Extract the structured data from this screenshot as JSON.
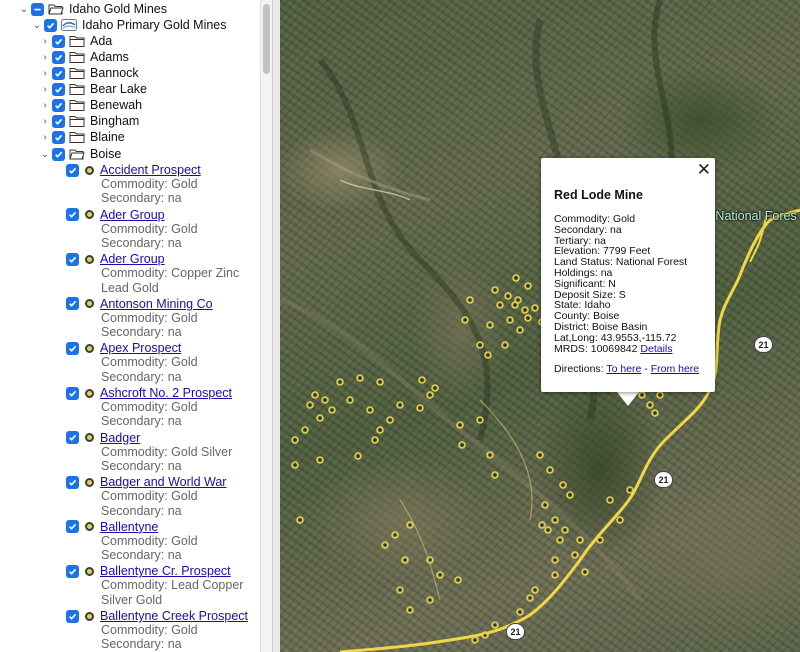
{
  "tree": {
    "root": {
      "label": "Idaho Gold Mines"
    },
    "layer": {
      "label": "Idaho Primary Gold Mines"
    },
    "counties": [
      "Ada",
      "Adams",
      "Bannock",
      "Bear Lake",
      "Benewah",
      "Bingham",
      "Blaine"
    ],
    "expanded_county": "Boise",
    "mines": [
      {
        "name": "Accident Prospect",
        "lines": [
          "Commodity: Gold",
          "Secondary: na"
        ]
      },
      {
        "name": "Ader Group",
        "lines": [
          "Commodity: Gold",
          "Secondary: na"
        ]
      },
      {
        "name": "Ader Group",
        "lines": [
          "Commodity: Copper Zinc",
          "Lead Gold"
        ]
      },
      {
        "name": "Antonson Mining Co",
        "lines": [
          "Commodity: Gold",
          "Secondary: na"
        ]
      },
      {
        "name": "Apex Prospect",
        "lines": [
          "Commodity: Gold",
          "Secondary: na"
        ]
      },
      {
        "name": "Ashcroft No. 2 Prospect",
        "lines": [
          "Commodity: Gold",
          "Secondary: na"
        ]
      },
      {
        "name": "Badger",
        "lines": [
          "Commodity: Gold Silver",
          "Secondary: na"
        ]
      },
      {
        "name": "Badger and World War",
        "lines": [
          "Commodity: Gold",
          "Secondary: na"
        ]
      },
      {
        "name": "Ballentyne",
        "lines": [
          "Commodity: Gold",
          "Secondary: na"
        ]
      },
      {
        "name": "Ballentyne Cr. Prospect",
        "lines": [
          "Commodity: Lead Copper",
          "Silver Gold"
        ]
      },
      {
        "name": "Ballentyne Creek Prospect",
        "lines": [
          "Commodity: Gold",
          "Secondary: na"
        ]
      }
    ]
  },
  "map": {
    "label": "e National Fores",
    "route_shields": [
      "21",
      "21",
      "21"
    ]
  },
  "popup": {
    "close": "✕",
    "title": "Red Lode Mine",
    "lines": [
      "Commodity: Gold",
      "Secondary: na",
      "Tertiary: na",
      "Elevation: 7799 Feet",
      "Land Status: National Forest",
      "Holdings: na",
      "Significant: N",
      "Deposit Size: S",
      "State: Idaho",
      "County: Boise",
      "District: Boise Basin",
      "Lat,Long: 43.9553,-115.72"
    ],
    "mrds_prefix": "MRDS: 10069842",
    "details_link": "Details",
    "directions_prefix": "Directions:",
    "to_here": "To here",
    "separator": "-",
    "from_here": "From here"
  },
  "colors": {
    "checkbox": "#1a73e8",
    "link": "#1a0dab",
    "road": "#f2d649",
    "mine_dot": "#e6d24a"
  }
}
